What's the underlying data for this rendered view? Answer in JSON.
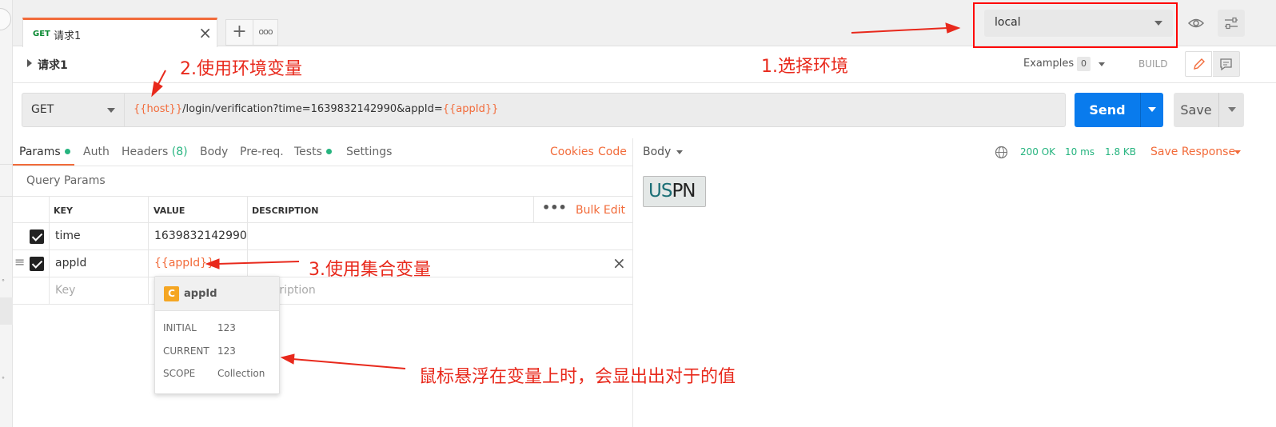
{
  "tabs": {
    "active": {
      "method": "GET",
      "name": "请求1"
    },
    "add_label": "+",
    "more_label": "ooo"
  },
  "environment": {
    "selected": "local"
  },
  "request": {
    "name": "请求1",
    "examples_label": "Examples",
    "examples_count": "0",
    "build_label": "BUILD",
    "method": "GET",
    "url_parts": [
      "{{host}}",
      "/login/verification?time=1639832142990&appId=",
      "{{appId}}"
    ],
    "send_label": "Send",
    "save_label": "Save"
  },
  "request_tabs": {
    "params": "Params",
    "auth": "Auth",
    "headers": "Headers",
    "headers_count": "(8)",
    "body": "Body",
    "prereq": "Pre-req.",
    "tests": "Tests",
    "settings": "Settings",
    "cookies": "Cookies",
    "code": "Code"
  },
  "params": {
    "title": "Query Params",
    "columns": {
      "key": "KEY",
      "value": "VALUE",
      "description": "DESCRIPTION"
    },
    "bulk_edit": "Bulk Edit",
    "rows": [
      {
        "key": "time",
        "value": "1639832142990",
        "checked": true
      },
      {
        "key": "appId",
        "value": "{{appId}}",
        "checked": true
      }
    ],
    "placeholder_key": "Key",
    "placeholder_description": "Description"
  },
  "variable_popup": {
    "badge": "C",
    "name": "appId",
    "initial_label": "INITIAL",
    "initial_value": "123",
    "current_label": "CURRENT",
    "current_value": "123",
    "scope_label": "SCOPE",
    "scope_value": "Collection"
  },
  "response": {
    "body_label": "Body",
    "status": "200 OK",
    "time": "10 ms",
    "size": "1.8 KB",
    "save_response": "Save Response",
    "logo_text_a": "US",
    "logo_text_b": "PN"
  },
  "annotations": {
    "env": "1.选择环境",
    "env_var": "2.使用环境变量",
    "collection_var": "3.使用集合变量",
    "hover": "鼠标悬浮在变量上时，会显出出对于的值"
  },
  "colors": {
    "accent": "#f26b3a",
    "primary": "#097bed",
    "success": "#26b47f",
    "annotation": "#e8291c"
  }
}
